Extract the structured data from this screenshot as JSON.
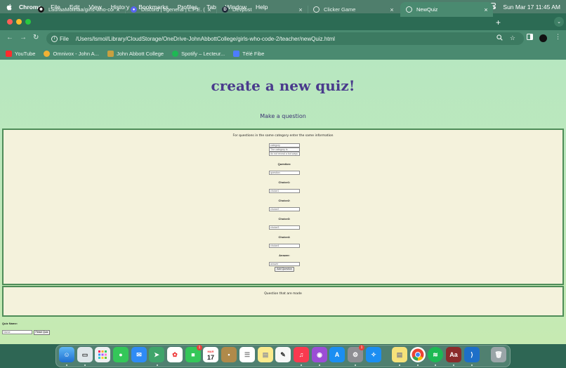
{
  "menubar": {
    "app": "Chrome",
    "items": [
      "File",
      "Edit",
      "View",
      "History",
      "Bookmarks",
      "Profiles",
      "Tab",
      "Window",
      "Help"
    ],
    "input_source": "CA",
    "clock": "Sun Mar 17  11:45 AM"
  },
  "tabs": [
    {
      "label": "LauraaMolinaa/girls-who-cod",
      "icon": "github-icon",
      "active": false
    },
    {
      "label": "Discord | #general | L.P.E. (Lo",
      "icon": "discord-icon",
      "active": false
    },
    {
      "label": "Devpost",
      "icon": "devpost-icon",
      "active": false
    },
    {
      "label": "Clicker Game",
      "icon": "globe-icon",
      "active": false
    },
    {
      "label": "NewQuiz",
      "icon": "globe-icon",
      "active": true
    }
  ],
  "address": {
    "scheme": "File",
    "url": "/Users/lsmol/Library/CloudStorage/OneDrive-JohnAbbottCollege/girls-who-code-2/teacher/newQuiz.html"
  },
  "bookmarks": [
    {
      "label": "YouTube",
      "color": "#ff2d2d"
    },
    {
      "label": "Omnivox - John A...",
      "color": "#f2b134"
    },
    {
      "label": "John Abbott College",
      "color": "#c8a040"
    },
    {
      "label": "Spotify – Lecteur...",
      "color": "#1db954"
    },
    {
      "label": "Télé Fibe",
      "color": "#4d7cff"
    }
  ],
  "page": {
    "title": "create a new quiz!",
    "subtitle": "Make a question",
    "form_heading": "For questions in the same category enter the same information",
    "category": {
      "placeholder": "category",
      "datalist": [
        "The category is",
        "do not reveal a but ways"
      ]
    },
    "question_label": "Question:",
    "question_placeholder": "question",
    "choices": [
      {
        "label": "Choice1:",
        "placeholder": "choice1"
      },
      {
        "label": "Choice2:",
        "placeholder": "choice2"
      },
      {
        "label": "Choice3:",
        "placeholder": "choice3"
      },
      {
        "label": "Choice4:",
        "placeholder": "choice4"
      }
    ],
    "answer_label": "Answer:",
    "answer_placeholder": "answer",
    "add_button": "Add Question",
    "made_heading": "Question that are made",
    "quiz_name_label": "Quiz Name:",
    "quiz_name_placeholder": "Name",
    "finish_button": "Finish Quiz"
  },
  "dock": {
    "badges": {
      "facetime": "1",
      "calendar_month": "MAR",
      "calendar_day": "17",
      "settings": "1"
    }
  },
  "colors": {
    "title": "#4a3b8c",
    "page_gradient_top": "#b7e7c0",
    "box_border": "#4e8c58",
    "box_fill": "#f4f2dc",
    "browser_chrome": "#4a8a70"
  }
}
